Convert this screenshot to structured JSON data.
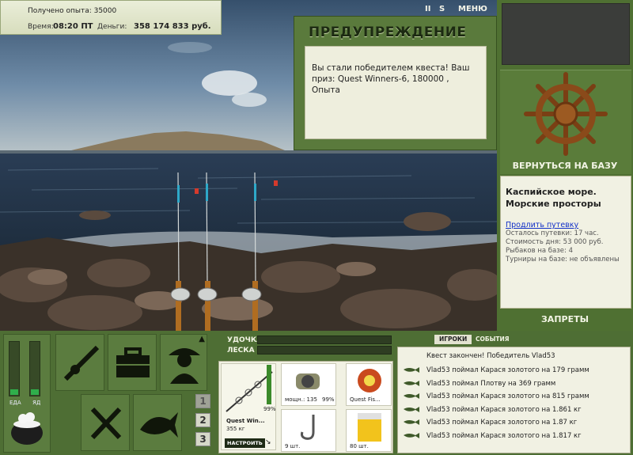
{
  "top_info": {
    "exp_text": "Получено опыта: 35000",
    "time_label": "Время:",
    "time_value": "08:20 ПТ",
    "money_label": "Деньги:",
    "money_value": "358 174 833 руб."
  },
  "controls": {
    "pause_glyph": "II",
    "sound_glyph": "S",
    "menu_label": "МЕНЮ"
  },
  "warning": {
    "title": "ПРЕДУПРЕЖДЕНИЕ",
    "message": "Вы стали победителем квеста! Ваш приз: Quest Winners-6, 180000 , Опыта"
  },
  "right_panel": {
    "back_label": "ВЕРНУТЬСЯ НА БАЗУ",
    "location_line1": "Каспийское море.",
    "location_line2": "Морские просторы",
    "extend_link": "Продлить путевку",
    "stats": [
      "Осталось путевки: 17 час.",
      "Стоимость дня: 53 000 руб.",
      "Рыбаков на базе: 4",
      "Турниры на базе: не объявлены"
    ],
    "bans_label": "ЗАПРЕТЫ"
  },
  "bottom": {
    "food_label": "ЕДА",
    "poison_label": "ЯД",
    "food_level": 0.1,
    "poison_level": 0.1,
    "page_numbers": [
      "1",
      "2",
      "3"
    ],
    "rod_label": "УДОЧКА",
    "line_label": "ЛЕСКА",
    "tackle": {
      "rod_name": "Quest Win...",
      "rod_weight": "355 кг",
      "rod_condition": "99%",
      "setup_button": "НАСТРОИТЬ",
      "reel_label": "мощн.: 135",
      "reel_condition": "99%",
      "line_name": "Quest Fis...",
      "hook_count": "9 шт.",
      "bait_count": "80 шт."
    }
  },
  "events": {
    "tab_players": "ИГРОКИ",
    "tab_events": "СОБЫТИЯ",
    "header": "Квест закончен! Победитель Vlad53",
    "rows": [
      "Vlad53 поймал Карася золотого на 179 грамм",
      "Vlad53 поймал Плотву на 369 грамм",
      "Vlad53 поймал Карася золотого на 815 грамм",
      "Vlad53 поймал Карася золотого на 1.861 кг",
      "Vlad53 поймал Карася золотого на 1.87 кг",
      "Vlad53 поймал Карася золотого на 1.817 кг"
    ]
  },
  "colors": {
    "panel_green": "#4e6e34",
    "accent_green": "#2fae4b",
    "paper": "#f1f1e3"
  }
}
